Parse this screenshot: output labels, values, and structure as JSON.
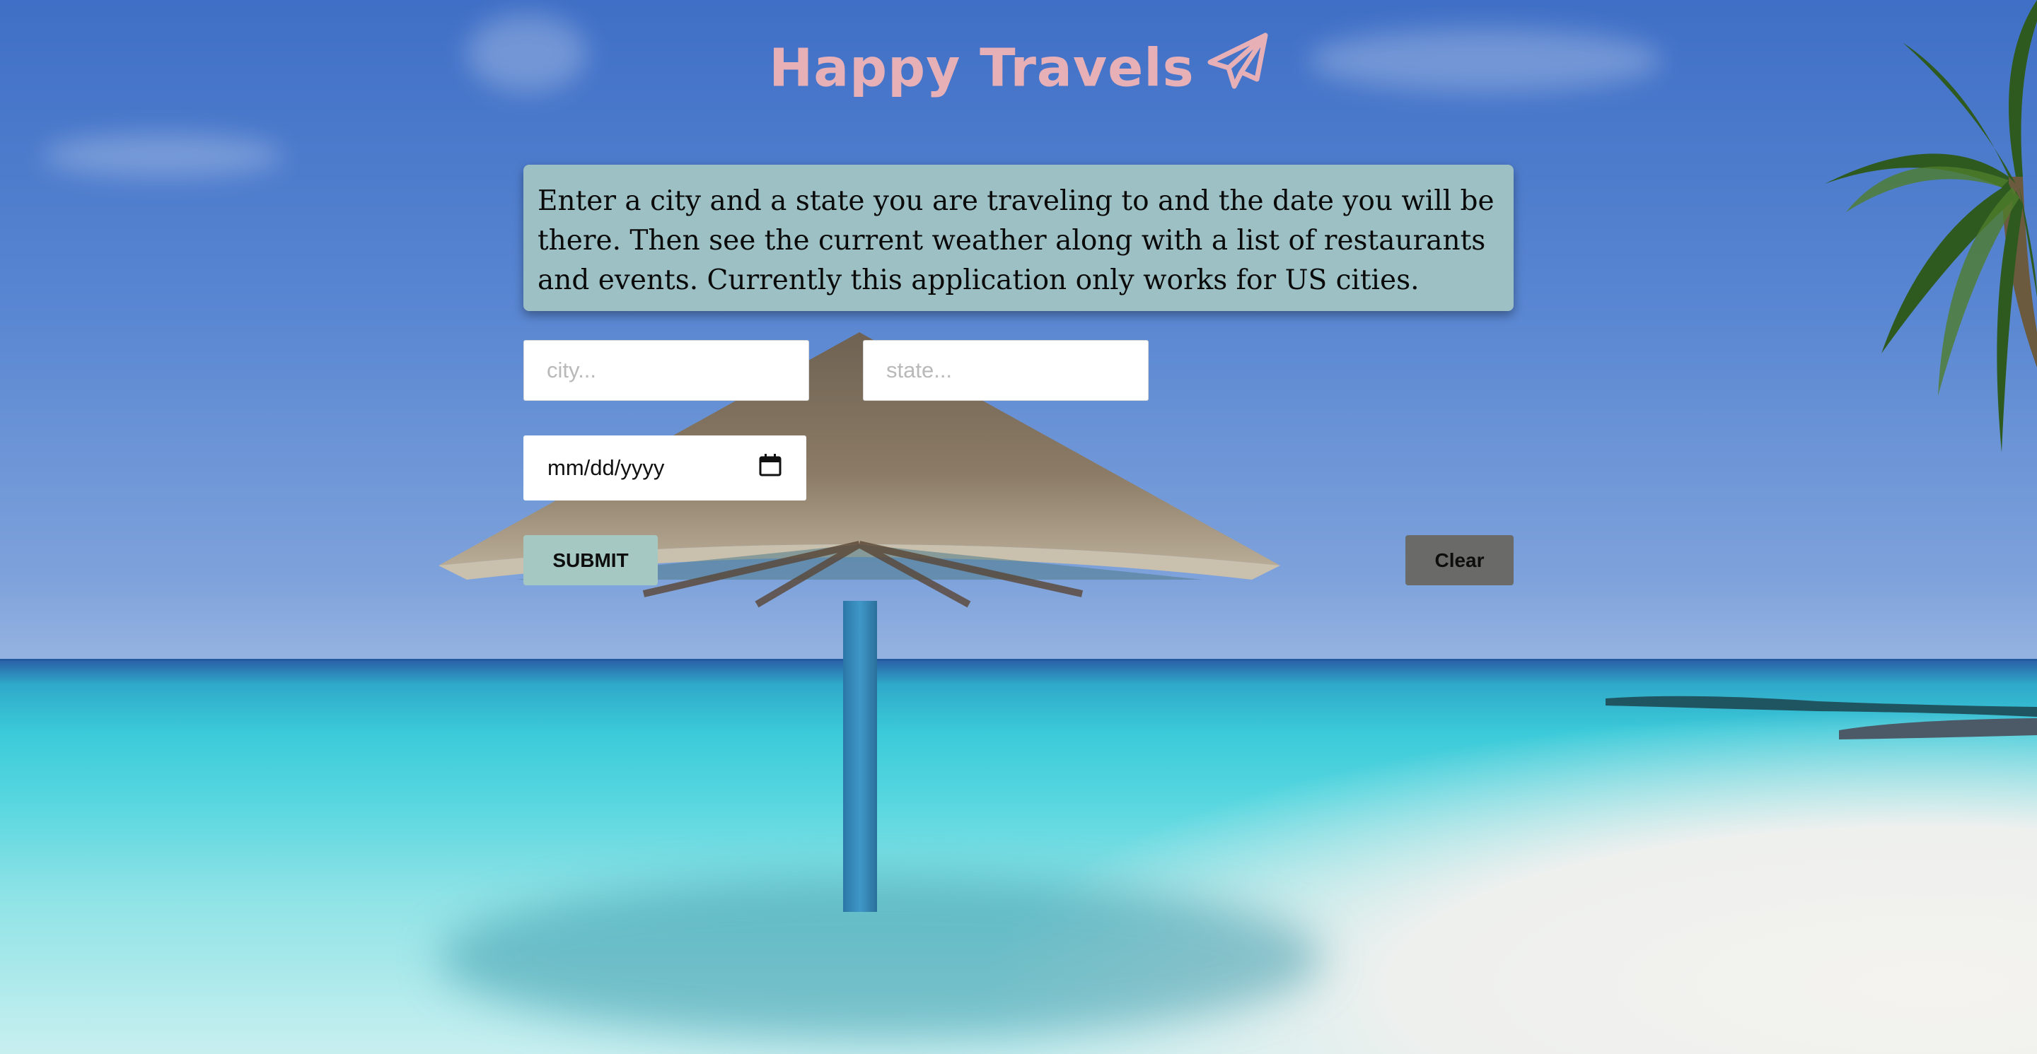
{
  "header": {
    "title": "Happy Travels",
    "title_color": "#e6b0b6",
    "icon": "paper-plane-icon"
  },
  "intro": {
    "text": "Enter a city and a state you are traveling to and the date you will be there. Then see the current weather along with a list of restaurants and events. Currently this application only works for US cities."
  },
  "form": {
    "city_placeholder": "city...",
    "state_placeholder": "state...",
    "date_value": "mm/dd/yyyy",
    "date_icon": "calendar-icon",
    "submit_label": "SUBMIT",
    "clear_label": "Clear"
  },
  "colors": {
    "info_box": "#9dc0c4",
    "submit_button": "#a6c8c2",
    "clear_button": "#6a6a68"
  }
}
